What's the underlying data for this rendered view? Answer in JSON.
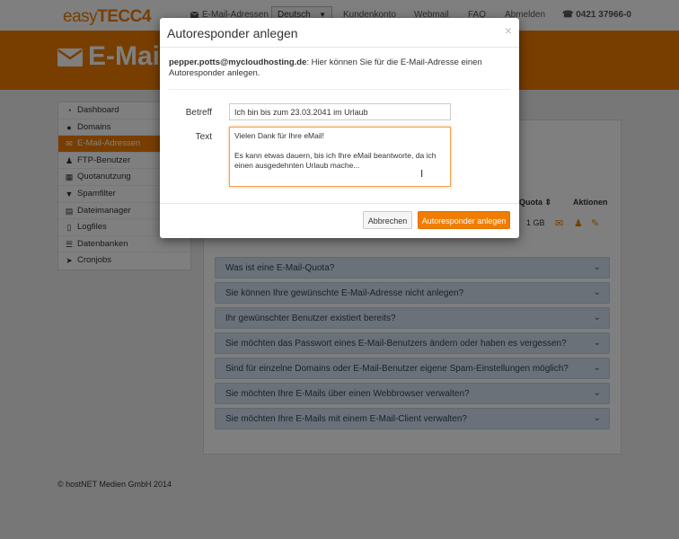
{
  "brand": {
    "logo_prefix": "easy",
    "logo_main": "TECC4"
  },
  "topnav": {
    "email": "E-Mail-Adressen",
    "language": "Deutsch",
    "account": "Kundenkonto",
    "webmail": "Webmail",
    "faq": "FAQ",
    "logout": "Abmelden",
    "phone": "0421 37966-0"
  },
  "banner": {
    "title": "E-Mail"
  },
  "sidebar": {
    "items": [
      {
        "label": "Dashboard",
        "icon": "dashboard-icon"
      },
      {
        "label": "Domains",
        "icon": "globe-icon"
      },
      {
        "label": "E-Mail-Adressen",
        "icon": "envelope-icon"
      },
      {
        "label": "FTP-Benutzer",
        "icon": "user-icon"
      },
      {
        "label": "Quotanutzung",
        "icon": "chart-icon"
      },
      {
        "label": "Spamfilter",
        "icon": "filter-icon"
      },
      {
        "label": "Dateimanager",
        "icon": "folder-icon"
      },
      {
        "label": "Logfiles",
        "icon": "file-icon"
      },
      {
        "label": "Datenbanken",
        "icon": "list-icon"
      },
      {
        "label": "Cronjobs",
        "icon": "rocket-icon"
      }
    ]
  },
  "table": {
    "col_quota": "Quota",
    "col_actions": "Aktionen",
    "row_quota": "1 GB"
  },
  "faq": [
    "Was ist eine E-Mail-Quota?",
    "Sie können Ihre gewünschte E-Mail-Adresse nicht anlegen?",
    "Ihr gewünschter Benutzer existiert bereits?",
    "Sie möchten das Passwort eines E-Mail-Benutzers ändern oder haben es vergessen?",
    "Sind für einzelne Domains oder E-Mail-Benutzer eigene Spam-Einstellungen möglich?",
    "Sie möchten Ihre E-Mails über einen Webbrowser verwalten?",
    "Sie möchten Ihre E-Mails mit einem E-Mail-Client verwalten?"
  ],
  "footer": {
    "copyright": "© hostNET Medien GmbH 2014"
  },
  "modal": {
    "title": "Autoresponder anlegen",
    "close": "×",
    "email": "pepper.potts@mycloudhosting.de",
    "description": ": Hier können Sie für die E-Mail-Adresse einen Autoresponder anlegen.",
    "subject_label": "Betreff",
    "subject_value": "Ich bin bis zum 23.03.2041 im Urlaub",
    "text_label": "Text",
    "text_value": "Vielen Dank für Ihre eMail!\n\nEs kann etwas dauern, bis ich Ihre eMail beantworte, da ich einen ausgedehnten Urlaub mache...",
    "cancel": "Abbrechen",
    "submit": "Autoresponder anlegen"
  },
  "colors": {
    "accent": "#f07d00",
    "faq_bg": "#d4e3f0"
  }
}
